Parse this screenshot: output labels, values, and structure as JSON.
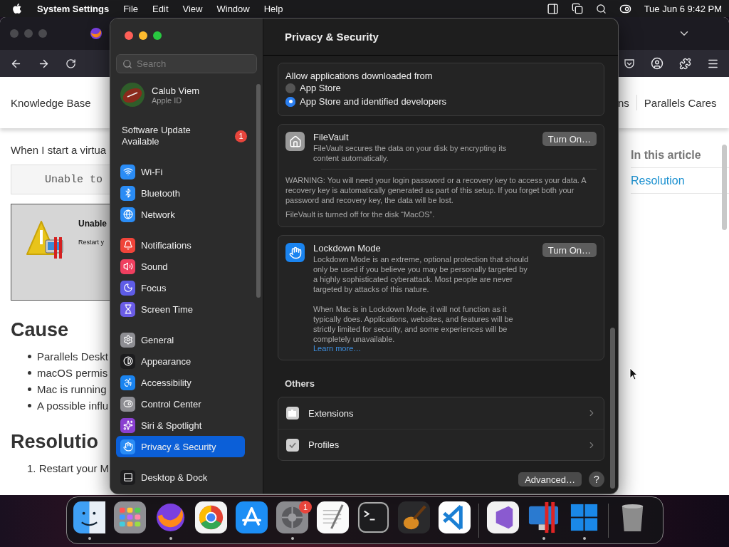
{
  "menu_bar": {
    "app_name": "System Settings",
    "menus": [
      "File",
      "Edit",
      "View",
      "Window",
      "Help"
    ],
    "clock": "Tue Jun 6 9:42 PM"
  },
  "browser": {
    "site_nav": {
      "left": "Knowledge Base",
      "right": [
        "ns",
        "Parallels Cares"
      ]
    },
    "article": {
      "intro": "When I start a virtua",
      "code": "Unable to",
      "error_title": "Unable",
      "error_text": "Restart y",
      "sections": [
        {
          "heading": "Cause",
          "kind": "bullets",
          "items": [
            "Parallels Deskt",
            "macOS permis",
            "Mac is running",
            "A possible influ"
          ]
        },
        {
          "heading": "Resolutio",
          "kind": "steps",
          "items": [
            "1. Restart your M"
          ]
        }
      ]
    },
    "toc": {
      "title": "In this article",
      "links": [
        "Resolution"
      ]
    }
  },
  "settings": {
    "title": "Privacy & Security",
    "search": {
      "placeholder": "Search"
    },
    "account": {
      "name": "Calub Viem",
      "subtitle": "Apple ID"
    },
    "update": {
      "label": "Software Update Available",
      "badge": "1"
    },
    "sidebar_groups": [
      [
        {
          "label": "Wi-Fi",
          "color": "#2a8cf5",
          "selected": false
        },
        {
          "label": "Bluetooth",
          "color": "#2a8cf5",
          "selected": false
        },
        {
          "label": "Network",
          "color": "#2a8cf5",
          "selected": false
        }
      ],
      [
        {
          "label": "Notifications",
          "color": "#f0443a",
          "selected": false
        },
        {
          "label": "Sound",
          "color": "#ef3f5f",
          "selected": false
        },
        {
          "label": "Focus",
          "color": "#5e5ce6",
          "selected": false
        },
        {
          "label": "Screen Time",
          "color": "#6a5ce6",
          "selected": false
        }
      ],
      [
        {
          "label": "General",
          "color": "#8e8e93",
          "selected": false
        },
        {
          "label": "Appearance",
          "color": "#1c1c1e",
          "selected": false
        },
        {
          "label": "Accessibility",
          "color": "#1a84f0",
          "selected": false
        },
        {
          "label": "Control Center",
          "color": "#8e8e93",
          "selected": false
        },
        {
          "label": "Siri & Spotlight",
          "color": "#8a3fd1",
          "selected": false
        },
        {
          "label": "Privacy & Security",
          "color": "#2a8cf5",
          "selected": true
        }
      ],
      [
        {
          "label": "Desktop & Dock",
          "color": "#1c1c1e",
          "selected": false
        }
      ]
    ],
    "download_source": {
      "title": "Allow applications downloaded from",
      "options": [
        {
          "label": "App Store",
          "selected": false
        },
        {
          "label": "App Store and identified developers",
          "selected": true
        }
      ]
    },
    "cards": [
      {
        "kind": "filevault",
        "title": "FileVault",
        "description": [
          "FileVault secures the data on your disk by encrypting its content automatically."
        ],
        "button": "Turn On…",
        "notes": [
          "WARNING: You will need your login password or a recovery key to access your data. A recovery key is automatically generated as part of this setup. If you forget both your password and recovery key, the data will be lost.",
          "FileVault is turned off for the disk “MacOS”."
        ]
      },
      {
        "kind": "lockdown",
        "title": "Lockdown Mode",
        "description": [
          "Lockdown Mode is an extreme, optional protection that should only be used if you believe you may be personally targeted by a highly sophisticated cyberattack. Most people are never targeted by attacks of this nature.",
          "When Mac is in Lockdown Mode, it will not function as it typically does. Applications, websites, and features will be strictly limited for security, and some experiences will be completely unavailable."
        ],
        "link": "Learn more…",
        "button": "Turn On…"
      }
    ],
    "others": {
      "title": "Others",
      "items": [
        "Extensions",
        "Profiles"
      ]
    },
    "footer": {
      "advanced": "Advanced…",
      "help": "?"
    }
  },
  "dock": {
    "groups": [
      [
        {
          "running": true
        },
        {
          "running": false
        },
        {
          "running": true
        },
        {
          "running": false
        },
        {
          "running": false
        },
        {
          "running": true,
          "badge": "1"
        },
        {
          "running": false
        },
        {
          "running": false
        },
        {
          "running": false
        },
        {
          "running": false
        }
      ],
      [
        {
          "running": false
        },
        {
          "running": true
        },
        {
          "running": true
        }
      ],
      [
        {
          "running": false
        }
      ]
    ]
  }
}
